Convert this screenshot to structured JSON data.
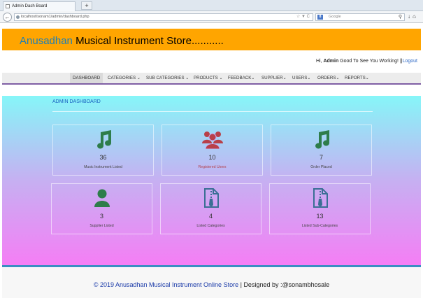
{
  "browser": {
    "tab_title": "Admin Dash Board",
    "new_tab": "+",
    "url": "localhost/sonam1/admin/dashboard.php",
    "search_engine": "8",
    "search_placeholder": "Google"
  },
  "header": {
    "brand": "Anusadhan",
    "title_rest": " Musical Instrument Store...........",
    "greeting_prefix": "Hi, ",
    "user": "Admin",
    "greeting_suffix": " Good To See You Working! ||",
    "logout": "Logout"
  },
  "nav": [
    {
      "label": "DASHBOARD"
    },
    {
      "label": "CATEGORIES ⌄"
    },
    {
      "label": "SUB CATEGORIES ⌄"
    },
    {
      "label": "PRODUCTS ⌄"
    },
    {
      "label": "FEEDBACK⌄"
    },
    {
      "label": "SUPPLIER⌄"
    },
    {
      "label": "USERS⌄"
    },
    {
      "label": "ORDERS⌄"
    },
    {
      "label": "REPORTS⌄"
    }
  ],
  "dashboard": {
    "title": "ADMIN DASHBOARD",
    "cards": [
      {
        "value": "36",
        "label": "Music Instrument Listed",
        "icon": "music-note-icon",
        "color": "#2e7d4a"
      },
      {
        "value": "10",
        "label": "Registered Users",
        "icon": "users-icon",
        "color": "#b84049"
      },
      {
        "value": "7",
        "label": "Order Placed",
        "icon": "music-note-icon",
        "color": "#2e7d4a"
      },
      {
        "value": "3",
        "label": "Supplier Listed",
        "icon": "user-icon",
        "color": "#2e7d4a"
      },
      {
        "value": "4",
        "label": "Listed Categories",
        "icon": "zip-file-icon",
        "color": "#3a6f94"
      },
      {
        "value": "13",
        "label": "Listed Sub-Categories",
        "icon": "zip-file-icon",
        "color": "#3a6f94"
      }
    ]
  },
  "footer": {
    "copyright": "© 2019 Anusadhan Musical Instrument Online Store",
    "separator": " | ",
    "designer": "Designed by :@sonambhosale"
  }
}
